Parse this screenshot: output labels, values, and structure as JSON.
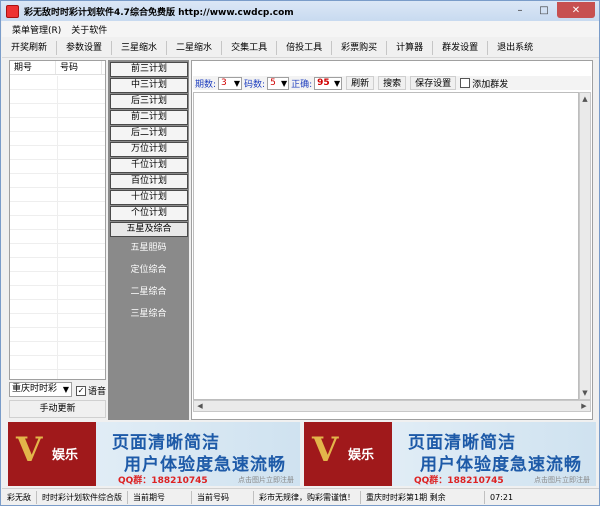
{
  "window": {
    "title": "彩无敌时时彩计划软件4.7综合免费版 http://www.cwdcp.com"
  },
  "menu": {
    "items": [
      "菜单管理(R)",
      "关于软件"
    ]
  },
  "toolbar": {
    "items": [
      "开奖刷新",
      "参数设置",
      "三星缩水",
      "二星缩水",
      "交集工具",
      "倍投工具",
      "彩票购买",
      "计算器",
      "群发设置",
      "退出系统"
    ]
  },
  "list": {
    "headers": [
      "期号",
      "号码"
    ]
  },
  "city_select": {
    "value": "重庆时时彩"
  },
  "voice": {
    "label": "语音",
    "checked": true
  },
  "manual_update": {
    "label": "手动更新"
  },
  "plans": {
    "buttons": [
      "前三计划",
      "中三计划",
      "后三计划",
      "前二计划",
      "后二计划",
      "万位计划",
      "千位计划",
      "百位计划",
      "十位计划",
      "个位计划",
      "五星及综合"
    ],
    "sub": [
      "五星胆码",
      "定位综合",
      "二星综合",
      "三星综合"
    ]
  },
  "controls": {
    "period_label": "期数:",
    "period_value": "3",
    "code_label": "码数:",
    "code_value": "5",
    "correct_label": "正确:",
    "correct_value": "95",
    "refresh": "刷新",
    "search": "搜索",
    "save": "保存设置",
    "group_label": "添加群发"
  },
  "ads": [
    {
      "logo_letters": "V",
      "logo_text": "娱乐",
      "headline": "页面清晰简洁",
      "subline": "用户体验度急速流畅",
      "qq": "QQ群：188210745",
      "hint": "点击图片立即注册"
    },
    {
      "logo_letters": "V",
      "logo_text": "娱乐",
      "headline": "页面清晰简洁",
      "subline": "用户体验度急速流畅",
      "qq": "QQ群：188210745",
      "hint": "点击图片立即注册"
    }
  ],
  "status": {
    "items": [
      "彩无敌",
      "时时彩计划软件综合版",
      "当前期号",
      "当前号码",
      "彩市无规律，购彩需谨慎！",
      "重庆时时彩第1期 剩余",
      "07:21"
    ]
  },
  "colors": {
    "label_blue": "#1f3fbf",
    "select_red": "#d00000",
    "ad_blue": "#1d5aa8",
    "ad_logo_red": "#a0191b",
    "plan_panel_gray": "#8a8a8a"
  }
}
